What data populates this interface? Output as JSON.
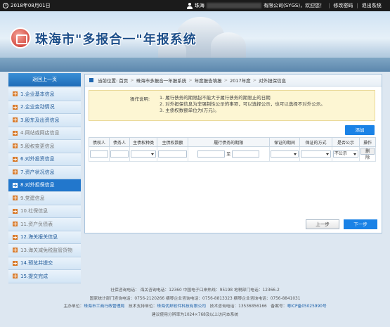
{
  "topbar": {
    "date": "2018年08月01日",
    "user_prefix": "珠海",
    "user_suffix": "有限公司(SYGS)，欢迎您！",
    "links": [
      "修改密码",
      "退出系统"
    ]
  },
  "banner": {
    "title": "珠海市\"多报合一\"年报系统"
  },
  "sidebar": {
    "back_label": "返回上一页",
    "items": [
      {
        "label": "1.企业基本信息",
        "state": "normal"
      },
      {
        "label": "2.企业变动情况",
        "state": "normal"
      },
      {
        "label": "3.股东及出资信息",
        "state": "normal"
      },
      {
        "label": "4.网站或网店信息",
        "state": "muted"
      },
      {
        "label": "5.股权变更信息",
        "state": "muted"
      },
      {
        "label": "6.对外投资信息",
        "state": "normal"
      },
      {
        "label": "7.资产状况信息",
        "state": "normal"
      },
      {
        "label": "8.对外担保信息",
        "state": "active"
      },
      {
        "label": "9.党建信息",
        "state": "muted"
      },
      {
        "label": "10.社保信息",
        "state": "muted"
      },
      {
        "label": "11.资产负债表",
        "state": "muted"
      },
      {
        "label": "12.海关报关信息",
        "state": "normal"
      },
      {
        "label": "13.海关减免税监管货物",
        "state": "muted"
      },
      {
        "label": "14.预览并提交",
        "state": "normal"
      },
      {
        "label": "15.提交完成",
        "state": "normal"
      }
    ]
  },
  "breadcrumb": [
    "当前位置: 首页",
    "珠海市多报合一年报系统",
    "年度报告填报",
    "2017年度",
    "对外担保信息"
  ],
  "notice": {
    "label": "操作说明:",
    "lines": [
      "1. 履行债务的期限起不能大于履行债务的期限止的日期",
      "2. 对外担保信息为非强制性公示的事项，可以选择公示，也可以选择不对外公示。",
      "3. 主债权数额单位为(万元)。"
    ]
  },
  "add_label": "添加",
  "table": {
    "headers": [
      "债权人",
      "债务人",
      "主债权种类",
      "主债权数额",
      "履行债务的期限",
      "保证的期间",
      "保证的方式",
      "是否公示",
      "操作"
    ],
    "range_sep": "至",
    "publish_value": "不公示",
    "delete_label": "删除"
  },
  "buttons": {
    "prev": "上一步",
    "next": "下一步"
  },
  "footer": {
    "line1": "社保咨询电话： 海关咨询电话：12360 中国电子口岸热线：95198 地税部门电话：12366-2",
    "line2": "国家统计部门咨询电话：0756-2120266 横琴企业咨询电话：0756-8813323 横琴企业咨询电话：0756-8841031",
    "line3_prefix": "主办单位：",
    "line3_org": "珠海市工商行政管理局",
    "line3_mid": "技术支持单位：",
    "line3_support": "珠海优邦软件科技有限公司",
    "line3_tel": "技术咨询电话：13536856166",
    "line3_icp_label": "备案号：",
    "line3_icp": "粤ICP备05025990号",
    "line4": "建议使用分辨率为1024×768及以上访问本系统"
  }
}
